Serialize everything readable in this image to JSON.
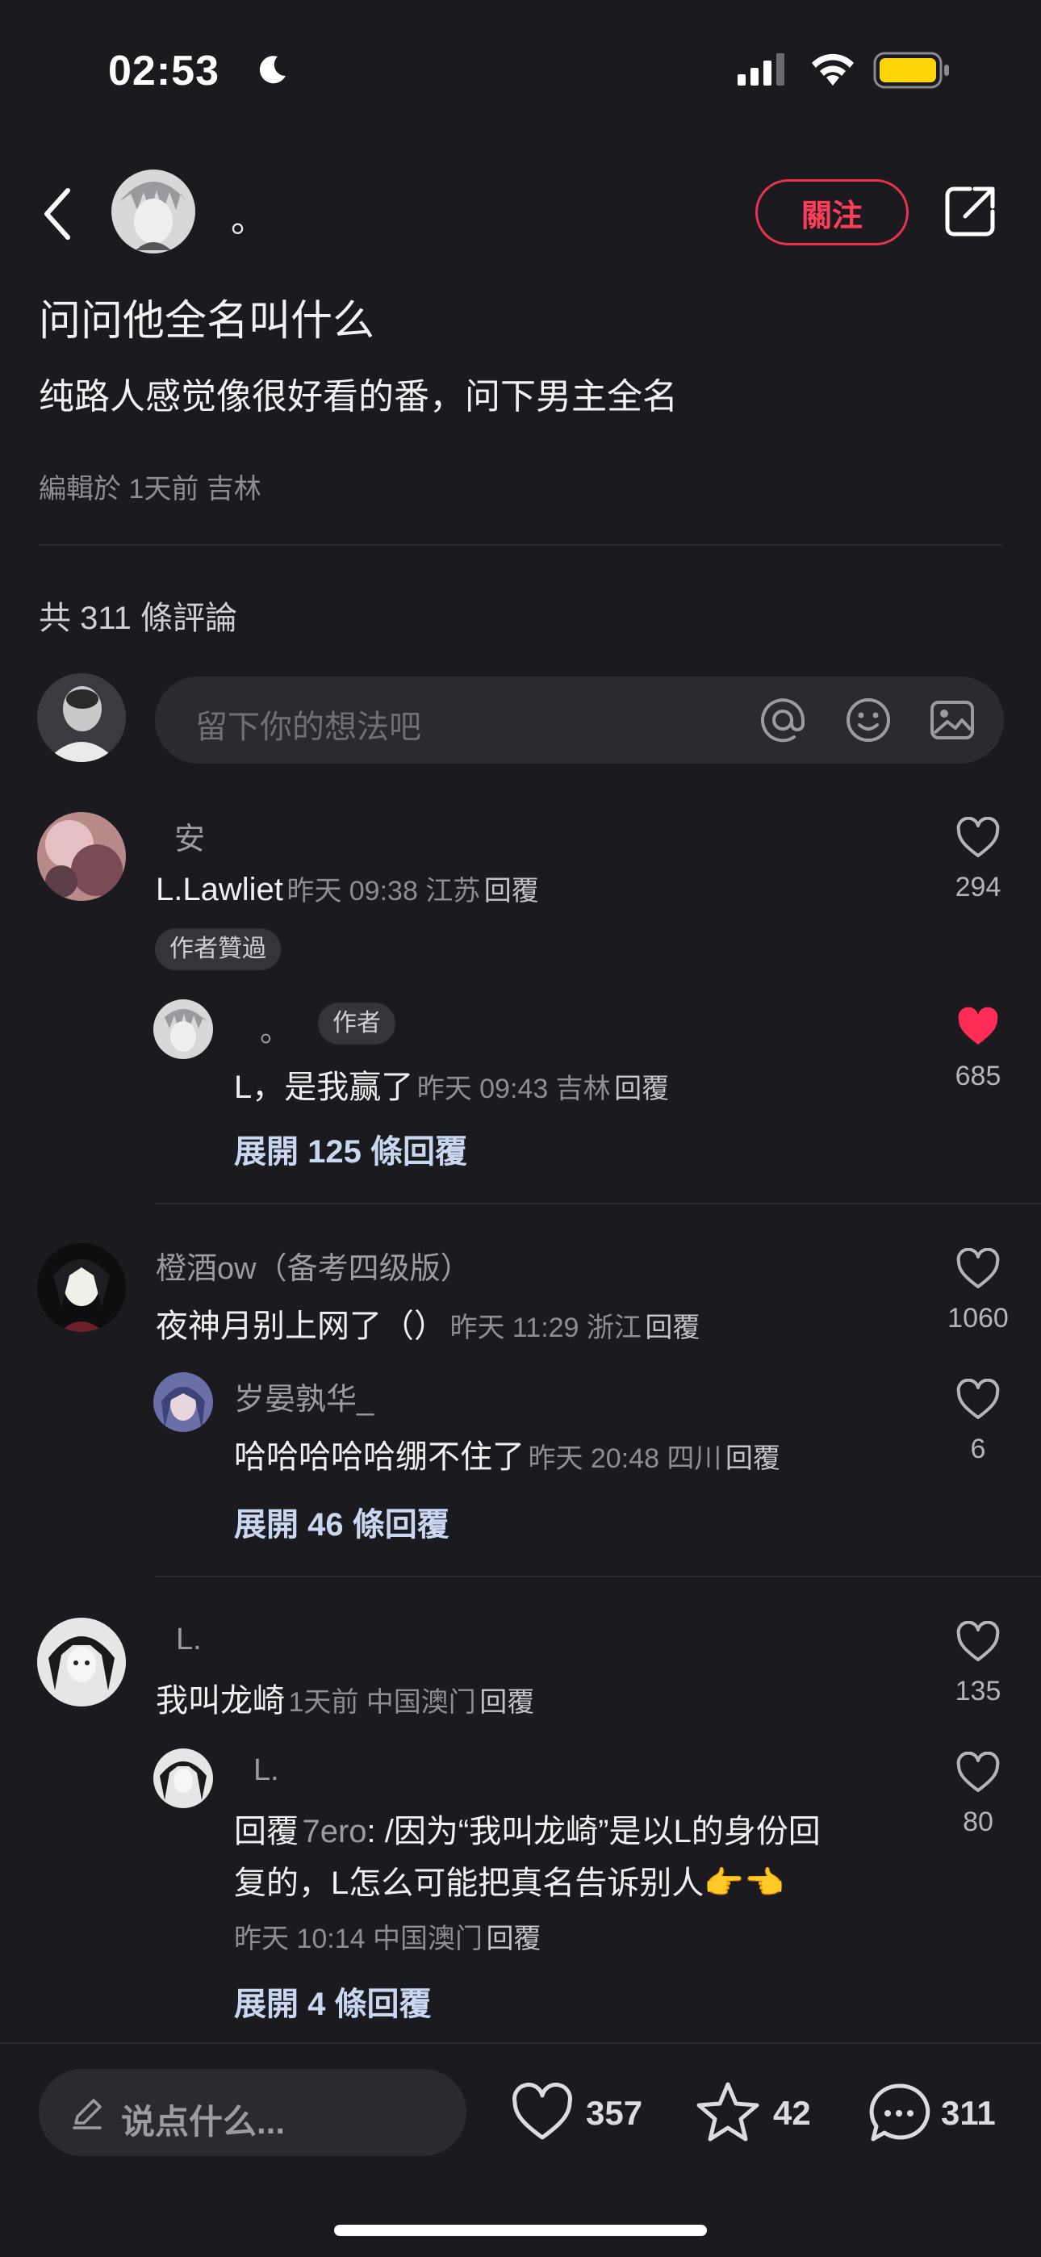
{
  "status_bar": {
    "time": "02:53"
  },
  "header": {
    "author_name": "。",
    "follow_label": "關注"
  },
  "post": {
    "title": "问问他全名叫什么",
    "body": "纯路人感觉像很好看的番，问下男主全名",
    "meta": "編輯於 1天前 吉林"
  },
  "comments_count": "共 311 條評論",
  "comment_input": {
    "placeholder": "留下你的想法吧"
  },
  "comments": [
    {
      "user": "安",
      "text": "L.Lawliet",
      "meta": "昨天 09:38 江苏",
      "reply": "回覆",
      "likes": "294",
      "badge": "作者贊過",
      "subreply": {
        "user": "。",
        "tag": "作者",
        "text": "L，是我赢了",
        "meta": "昨天 09:43 吉林",
        "reply": "回覆",
        "likes": "685"
      },
      "expand": "展開 125 條回覆"
    },
    {
      "user": "橙酒ow（备考四级版）",
      "text": "夜神月别上网了（）",
      "meta": "昨天 11:29 浙江",
      "reply": "回覆",
      "likes": "1060",
      "subreply": {
        "user": "岁晏孰华_",
        "text": "哈哈哈哈哈绷不住了",
        "meta": "昨天 20:48 四川",
        "reply": "回覆",
        "likes": "6"
      },
      "expand": "展開 46 條回覆"
    },
    {
      "user": "L.",
      "text": "我叫龙崎",
      "meta": "1天前 中国澳门",
      "reply": "回覆",
      "likes": "135",
      "subreply": {
        "user": "L.",
        "reply_prefix": "回覆",
        "reply_to": "7ero",
        "line1": ": /因为“我叫龙崎”是以L的身份回",
        "line2": "复的，L怎么可能把真名告诉别人👉👈",
        "meta": "昨天 10:14 中国澳门",
        "reply": "回覆",
        "likes": "80"
      },
      "expand": "展開 4 條回覆"
    }
  ],
  "bottom_bar": {
    "placeholder": "说点什么...",
    "likes": "357",
    "stars": "42",
    "comments": "311"
  },
  "colors": {
    "accent": "#ff3d5a",
    "background": "#1b1b1f",
    "expand": "#c9d7f0"
  }
}
